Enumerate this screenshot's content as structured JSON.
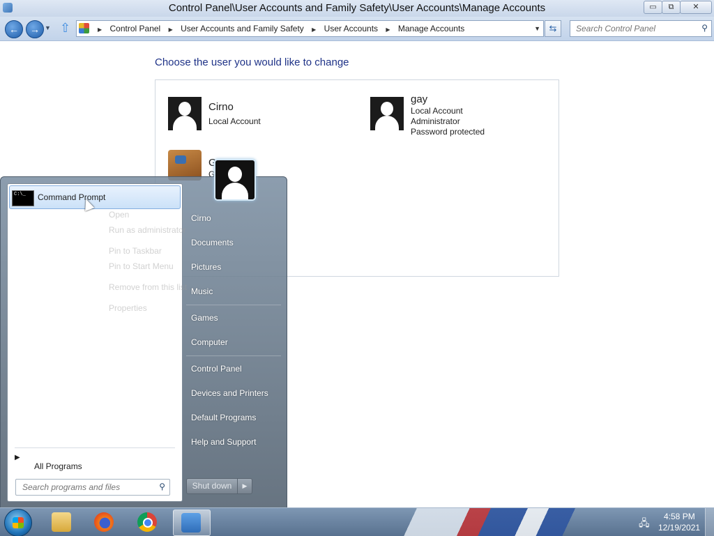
{
  "window": {
    "title": "Control Panel\\User Accounts and Family Safety\\User Accounts\\Manage Accounts",
    "buttons": {
      "minimize": "▭",
      "maximize": "⧉",
      "close": "✕"
    }
  },
  "address": {
    "back_icon": "back-arrow-icon",
    "forward_icon": "forward-arrow-icon",
    "breadcrumbs": [
      "Control Panel",
      "User Accounts and Family Safety",
      "User Accounts",
      "Manage Accounts"
    ],
    "search_placeholder": "Search Control Panel"
  },
  "content": {
    "heading": "Choose the user you would like to change",
    "accounts": [
      {
        "name": "Cirno",
        "details": [
          "Local Account"
        ]
      },
      {
        "name": "gay",
        "details": [
          "Local Account",
          "Administrator",
          "Password protected"
        ]
      },
      {
        "name": "G",
        "details": [
          "G                  t is off"
        ]
      }
    ]
  },
  "start_menu": {
    "pinned": [
      {
        "label": "Command Prompt",
        "icon": "command-prompt-icon",
        "icon_text": "C:\\_"
      }
    ],
    "ghost_context_menu": [
      "Open",
      "Run as administrator",
      "Pin to Taskbar",
      "Pin to Start Menu",
      "Remove from this list",
      "Properties"
    ],
    "all_programs": "All Programs",
    "search_placeholder": "Search programs and files",
    "right_items": [
      "Cirno",
      "Documents",
      "Pictures",
      "Music",
      "Games",
      "Computer",
      "Control Panel",
      "Devices and Printers",
      "Default Programs",
      "Help and Support"
    ],
    "shutdown": "Shut down"
  },
  "taskbar": {
    "apps": [
      "windows-explorer-icon",
      "firefox-icon",
      "chrome-icon",
      "control-panel-icon"
    ],
    "clock_time": "4:58 PM",
    "clock_date": "12/19/2021"
  }
}
